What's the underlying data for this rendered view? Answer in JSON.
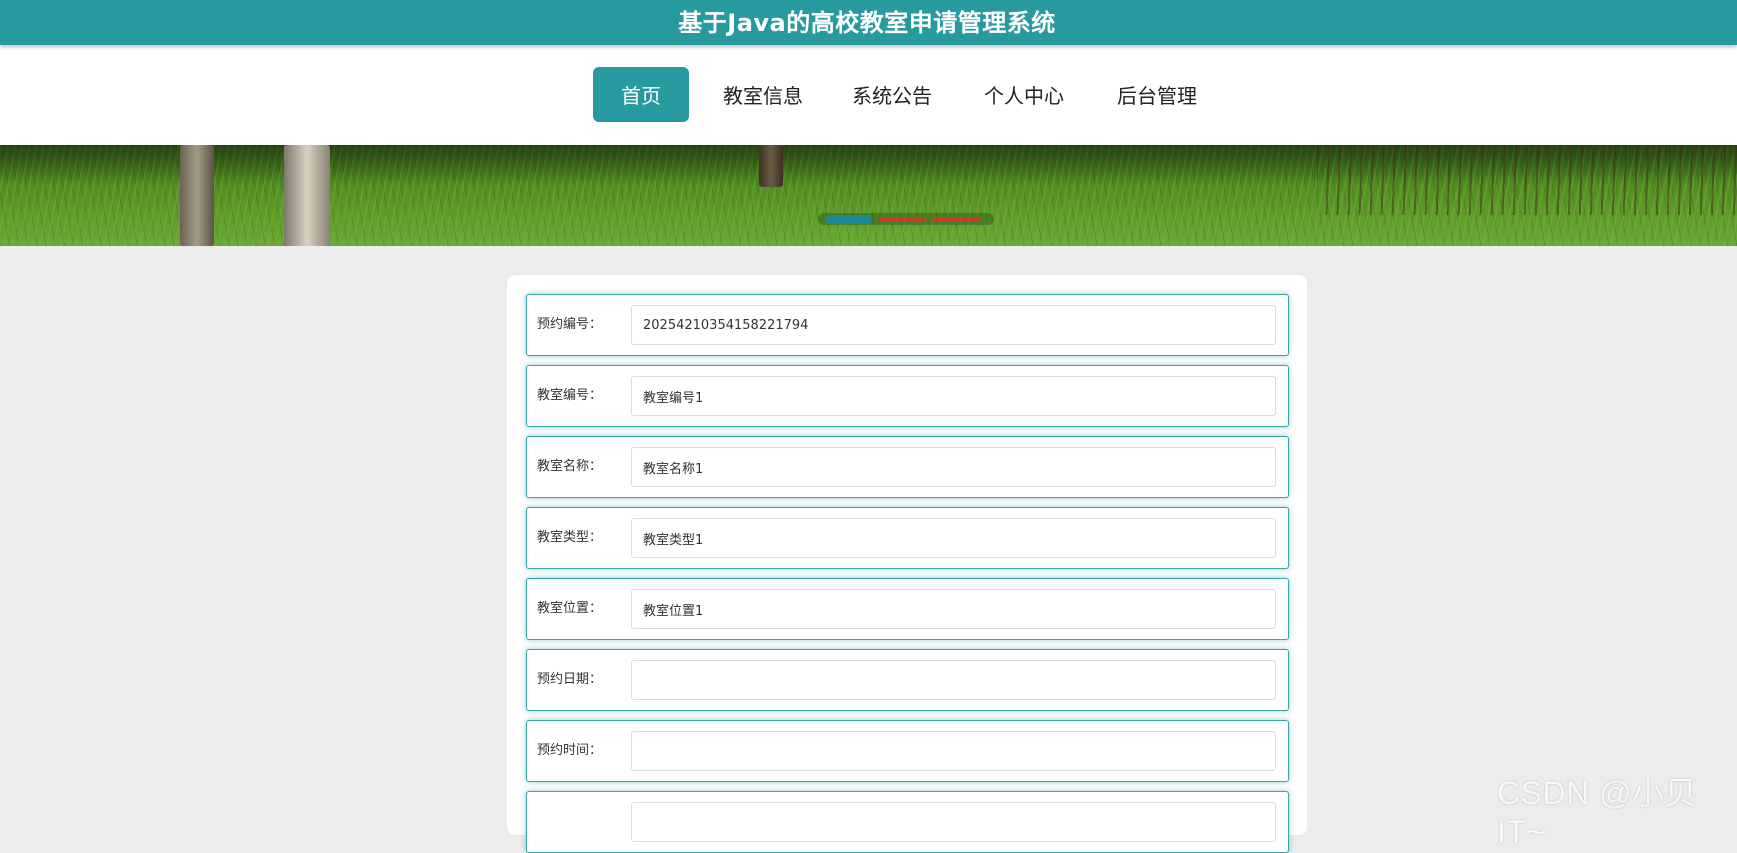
{
  "header": {
    "title": "基于Java的高校教室申请管理系统"
  },
  "nav": {
    "items": [
      {
        "label": "首页"
      },
      {
        "label": "教室信息"
      },
      {
        "label": "系统公告"
      },
      {
        "label": "个人中心"
      },
      {
        "label": "后台管理"
      }
    ],
    "active_index": 0
  },
  "banner": {
    "slides": 3,
    "active_slide": 1
  },
  "form": {
    "fields": [
      {
        "label": "预约编号：",
        "value": "20254210354158221794"
      },
      {
        "label": "教室编号：",
        "value": "教室编号1"
      },
      {
        "label": "教室名称：",
        "value": "教室名称1"
      },
      {
        "label": "教室类型：",
        "value": "教室类型1"
      },
      {
        "label": "教室位置：",
        "value": "教室位置1"
      },
      {
        "label": "预约日期：",
        "value": ""
      },
      {
        "label": "预约时间：",
        "value": ""
      },
      {
        "label": "",
        "value": ""
      }
    ]
  },
  "watermark": "CSDN @小贝IT~",
  "colors": {
    "primary": "#269a9f",
    "page_bg": "#ececec"
  }
}
